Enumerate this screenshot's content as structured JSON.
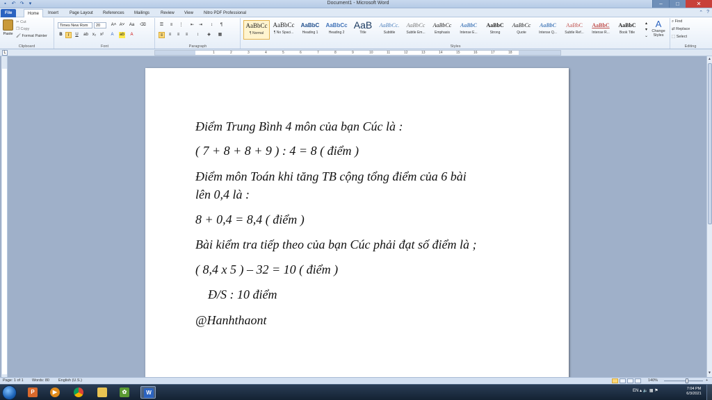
{
  "window": {
    "title": "Document1 - Microsoft Word",
    "controls": {
      "minimize": "–",
      "maximize": "□",
      "close": "✕"
    }
  },
  "quick_access": [
    {
      "icon": "save-icon",
      "glyph": "▪"
    },
    {
      "icon": "undo-icon",
      "glyph": "↶"
    },
    {
      "icon": "redo-icon",
      "glyph": "↷"
    },
    {
      "icon": "customize-icon",
      "glyph": "▾"
    }
  ],
  "tabs": [
    {
      "label": "File"
    },
    {
      "label": "Home"
    },
    {
      "label": "Insert"
    },
    {
      "label": "Page Layout"
    },
    {
      "label": "References"
    },
    {
      "label": "Mailings"
    },
    {
      "label": "Review"
    },
    {
      "label": "View"
    },
    {
      "label": "Nitro PDF Professional"
    }
  ],
  "clipboard": {
    "paste": "Paste",
    "cut": "Cut",
    "copy": "Copy",
    "format_painter": "Format Painter",
    "label": "Clipboard"
  },
  "font": {
    "name": "Times New Rom",
    "size": "20",
    "label": "Font"
  },
  "paragraph": {
    "label": "Paragraph"
  },
  "styles": {
    "label": "Styles",
    "items": [
      {
        "preview": "AaBbCc",
        "name": "¶ Normal"
      },
      {
        "preview": "AaBbCc",
        "name": "¶ No Spaci..."
      },
      {
        "preview": "AaBbC",
        "name": "Heading 1"
      },
      {
        "preview": "AaBbCc",
        "name": "Heading 2"
      },
      {
        "preview": "AaB",
        "name": "Title"
      },
      {
        "preview": "AaBbCc.",
        "name": "Subtitle"
      },
      {
        "preview": "AaBbCc",
        "name": "Subtle Em..."
      },
      {
        "preview": "AaBbCc",
        "name": "Emphasis"
      },
      {
        "preview": "AaBbC",
        "name": "Intense E..."
      },
      {
        "preview": "AaBbC",
        "name": "Strong"
      },
      {
        "preview": "AaBbCc",
        "name": "Quote"
      },
      {
        "preview": "AaBbC",
        "name": "Intense Q..."
      },
      {
        "preview": "AaBbC",
        "name": "Subtle Ref..."
      },
      {
        "preview": "AaBbC",
        "name": "Intense R..."
      },
      {
        "preview": "AaBbC",
        "name": "Book Title"
      }
    ],
    "change_styles": "Change Styles"
  },
  "editing": {
    "find": "Find",
    "replace": "Replace",
    "select": "Select",
    "label": "Editing"
  },
  "ruler_numbers": [
    "1",
    "2",
    "3",
    "4",
    "5",
    "6",
    "7",
    "8",
    "9",
    "10",
    "11",
    "12",
    "13",
    "14",
    "15",
    "16",
    "17",
    "18"
  ],
  "document": {
    "lines": [
      "Điểm Trung Bình 4 môn của bạn Cúc là :",
      "( 7 + 8 + 8 + 9 ) : 4 = 8 ( điểm )",
      "Điểm  môn Toán  khi tăng TB cộng tổng điểm của 6 bài",
      "lên 0,4 là :",
      "8 + 0,4 = 8,4 ( điểm )",
      "Bài kiểm tra tiếp theo của bạn Cúc phải đạt số điểm là ;",
      "( 8,4 x 5 ) – 32 = 10 ( điểm )",
      "Đ/S : 10 điểm",
      "@Hanhthaont"
    ]
  },
  "status": {
    "page": "Page: 1 of 1",
    "words": "Words: 80",
    "language": "English (U.S.)",
    "zoom": "140%"
  },
  "taskbar": {
    "apps": [
      "paint",
      "media-player",
      "chrome",
      "file-explorer",
      "plants-vs-zombies",
      "word"
    ],
    "lang": "EN",
    "time": "7:04 PM",
    "date": "6/3/2021"
  }
}
